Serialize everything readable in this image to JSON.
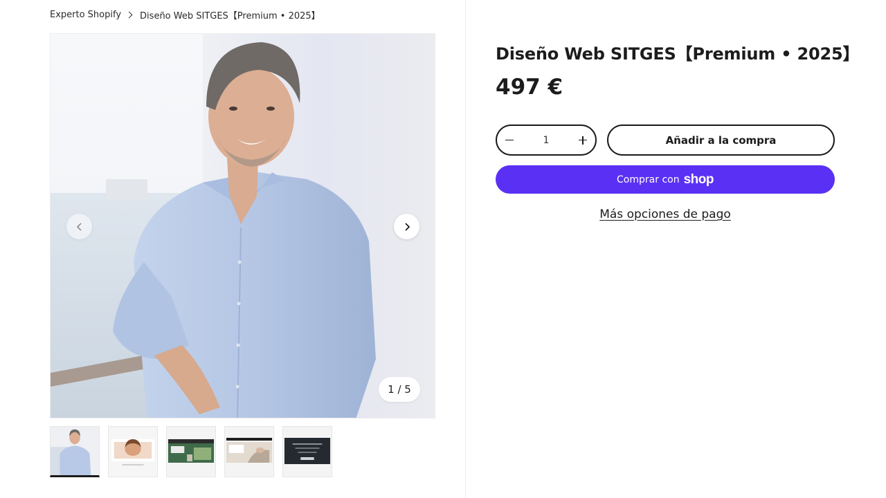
{
  "breadcrumb": {
    "home": "Experto Shopify",
    "current": "Diseño Web SITGES【Premium • 2025】"
  },
  "gallery": {
    "counter": "1 / 5",
    "prev_icon": "chevron-left-icon",
    "next_icon": "chevron-right-icon",
    "thumbnail_count": 5,
    "active_index": 0
  },
  "product": {
    "title": "Diseño Web SITGES【Premium • 2025】",
    "price": "497 €"
  },
  "quantity": {
    "value": "1",
    "minus_icon": "minus-icon",
    "plus_icon": "plus-icon"
  },
  "actions": {
    "add_to_cart": "Añadir a la compra",
    "shop_pay_label": "Comprar con",
    "shop_pay_logo": "shop",
    "more_options": "Más opciones de pago"
  },
  "colors": {
    "shop_pay": "#5a31f4",
    "text": "#1c1c1c",
    "shirt": "#b7c9e6"
  }
}
